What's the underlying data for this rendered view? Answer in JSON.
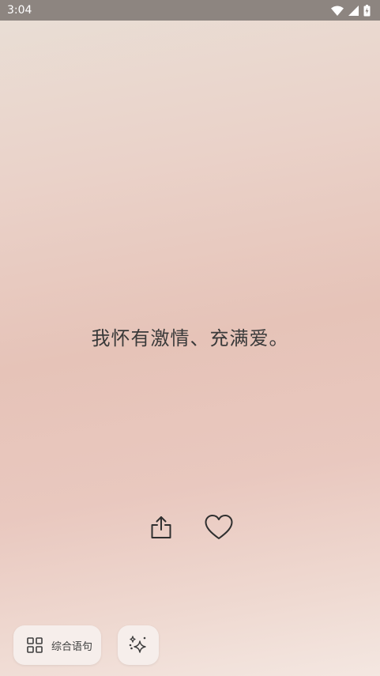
{
  "status_bar": {
    "time": "3:04",
    "icons": [
      "wifi-icon",
      "cellular-signal-icon",
      "battery-charging-icon"
    ]
  },
  "quote": {
    "text": "我怀有激情、充满爱。"
  },
  "actions": {
    "share_icon": "share-icon",
    "like_icon": "heart-icon"
  },
  "bottom_bar": {
    "category_label": "综合语句",
    "category_icon": "grid-icon",
    "sparkle_icon": "sparkle-icon"
  },
  "colors": {
    "status_bar_bg": "#8d8580",
    "text": "#3a3a3a",
    "pill_bg": "#f6eeeb"
  }
}
